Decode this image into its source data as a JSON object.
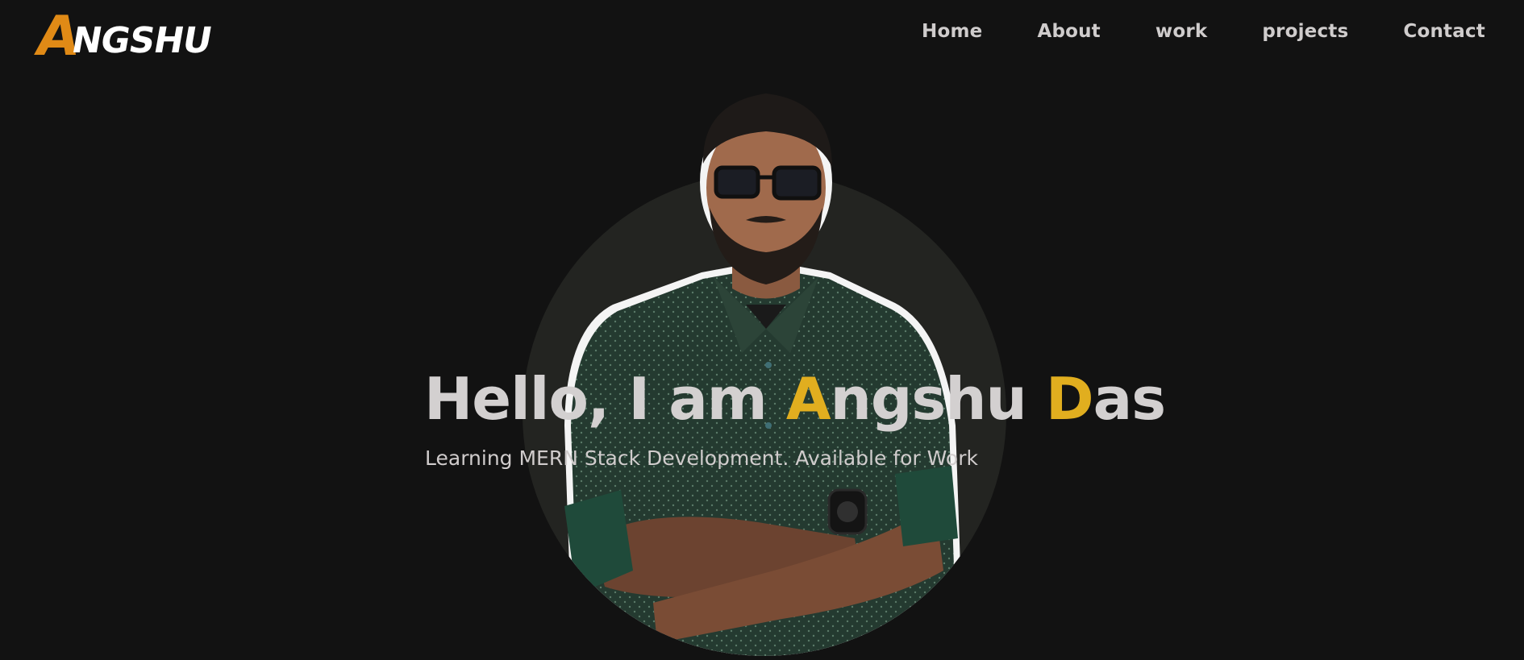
{
  "header": {
    "logo": {
      "first_letter": "A",
      "rest": "NGSHU"
    },
    "nav": [
      {
        "label": "Home"
      },
      {
        "label": "About"
      },
      {
        "label": "work"
      },
      {
        "label": "projects"
      },
      {
        "label": "Contact"
      }
    ]
  },
  "hero": {
    "title": {
      "greeting": "Hello, I am ",
      "first_initial": "A",
      "first_rest": "ngshu ",
      "last_initial": "D",
      "last_rest": "as"
    },
    "subtitle": "Learning MERN Stack Development. Available for Work"
  },
  "colors": {
    "background": "#121212",
    "logo_accent": "#e08a16",
    "name_accent": "#e1ae1f",
    "text": "#d3d0d0",
    "circle": "#232421"
  }
}
